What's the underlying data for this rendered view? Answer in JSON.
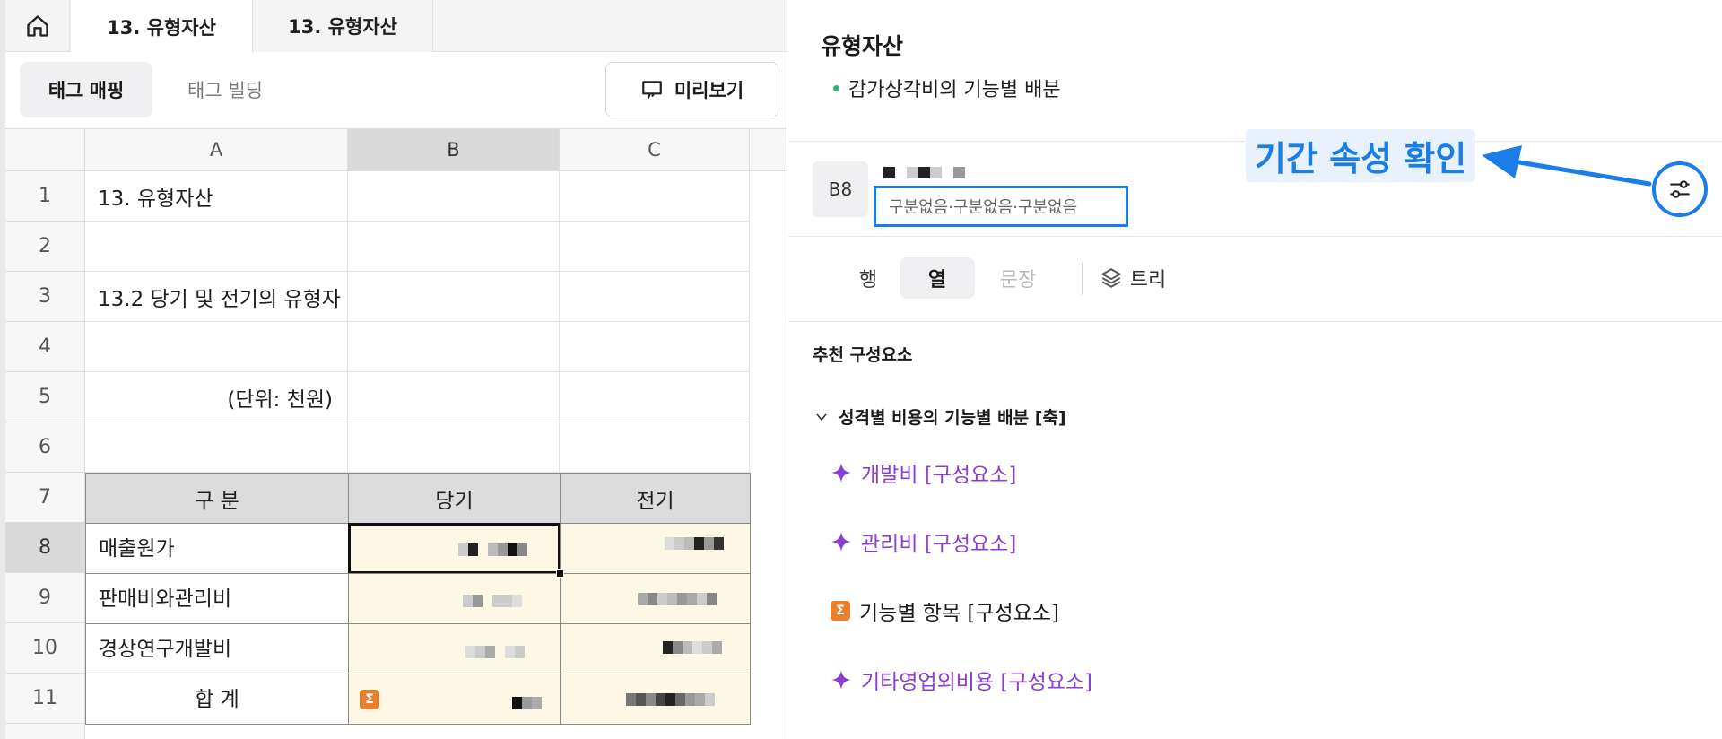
{
  "tabs": {
    "items": [
      "13. 유형자산",
      "13. 유형자산"
    ]
  },
  "toolbar": {
    "tag_mapping": "태그 매핑",
    "tag_building": "태그 빌딩",
    "preview": "미리보기"
  },
  "sheet": {
    "columns": [
      "A",
      "B",
      "C"
    ],
    "rows": [
      "1",
      "2",
      "3",
      "4",
      "5",
      "6",
      "7",
      "8",
      "9",
      "10",
      "11"
    ],
    "selected_cell": "B8",
    "cells": {
      "a1": "13. 유형자산",
      "a3": "13.2 당기 및 전기의 유형자",
      "a5": "(단위: 천원)",
      "a7": "구 분",
      "b7": "당기",
      "c7": "전기",
      "a8": "매출원가",
      "a9": "판매비와관리비",
      "a10": "경상연구개발비",
      "a11": "합 계"
    },
    "sum_icon": "Σ"
  },
  "panel": {
    "title": "유형자산",
    "bullet": "감가상각비의 기능별 배분",
    "cell_ref": "B8",
    "attributes": "구분없음·구분없음·구분없음",
    "annotation": "기간 속성 확인",
    "segments": {
      "row": "행",
      "column": "열",
      "sentence": "문장",
      "tree": "트리"
    },
    "recommend_title": "추천 구성요소",
    "axis_label": "성격별 비용의 기능별 배분 [축]",
    "components": [
      {
        "label": "개발비 [구성요소]",
        "icon": "sparkle-icon"
      },
      {
        "label": "관리비 [구성요소]",
        "icon": "sparkle-icon"
      },
      {
        "label": "기능별 항목 [구성요소]",
        "icon": "sum-icon"
      },
      {
        "label": "기타영업외비용 [구성요소]",
        "icon": "sparkle-icon"
      }
    ]
  },
  "colors": {
    "accent_blue": "#1a7de8",
    "purple": "#8a3fd1",
    "sum_orange": "#e8812f",
    "bullet_green": "#2bb673",
    "cell_yellow": "#fdf8e6"
  }
}
